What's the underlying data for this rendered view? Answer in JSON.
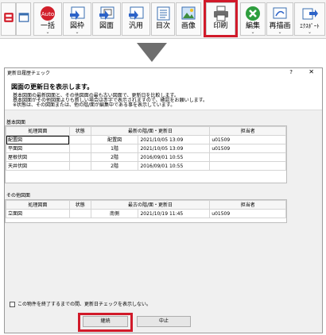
{
  "toolbar": {
    "buttons": [
      {
        "label": "",
        "icon": "printer-save-icon"
      },
      {
        "label": "",
        "icon": "window-icon"
      },
      {
        "label": "一括",
        "icon": "auto-icon",
        "badge": "Auto"
      },
      {
        "label": "図枠",
        "icon": "frame-icon"
      },
      {
        "label": "図面",
        "icon": "drawing-icon"
      },
      {
        "label": "汎用",
        "icon": "general-icon"
      },
      {
        "label": "目次",
        "icon": "contents-icon"
      },
      {
        "label": "画像",
        "icon": "image-icon"
      },
      {
        "label": "印刷",
        "icon": "printer-icon"
      },
      {
        "label": "編集",
        "icon": "edit-icon"
      },
      {
        "label": "再描画",
        "icon": "redraw-icon"
      },
      {
        "label": "ｴｸｽﾎﾟｰﾄ",
        "icon": "export-icon"
      }
    ],
    "chevron": "⌄"
  },
  "dialog": {
    "title": "更新日履歴チェック",
    "help": "?",
    "close": "✕",
    "heading": "図面の更新日を表示します。",
    "lines": [
      "基本図面の最新図面と、その他図面の最も古い図面で、更新日を比較します。",
      "基本図面がその他図面よりも新しい場合は赤字で表示されますので、確認をお願いします。",
      "※状態は、その図面または、他の階/面が編集中である事を表示しています。"
    ],
    "basic_section": "基本図面",
    "other_section": "その他図面",
    "basic_columns": [
      "処理図面",
      "状態",
      "最新の階/面・更新日",
      "",
      "担当者"
    ],
    "other_columns": [
      "処理図面",
      "状態",
      "最古の階/面・更新日",
      "",
      "担当者"
    ],
    "basic_rows": [
      {
        "drawing": "配置図",
        "status": "",
        "floor": "配置図",
        "date": "2021/10/05  13:09",
        "person": "u01509"
      },
      {
        "drawing": "平面図",
        "status": "",
        "floor": "1階",
        "date": "2021/10/05  13:09",
        "person": "u01509"
      },
      {
        "drawing": "屋根伏図",
        "status": "",
        "floor": "2階",
        "date": "2016/09/01  10:55",
        "person": ""
      },
      {
        "drawing": "天井伏図",
        "status": "",
        "floor": "2階",
        "date": "2016/09/01  10:55",
        "person": ""
      }
    ],
    "other_rows": [
      {
        "drawing": "立面図",
        "status": "",
        "floor": "南側",
        "date": "2021/10/19  11:45",
        "person": "u01509"
      }
    ],
    "checkbox_label": "この物件を終了するまでの間、更新日チェックを表示しない。",
    "continue_button": "継続",
    "cancel_button": "中止"
  }
}
